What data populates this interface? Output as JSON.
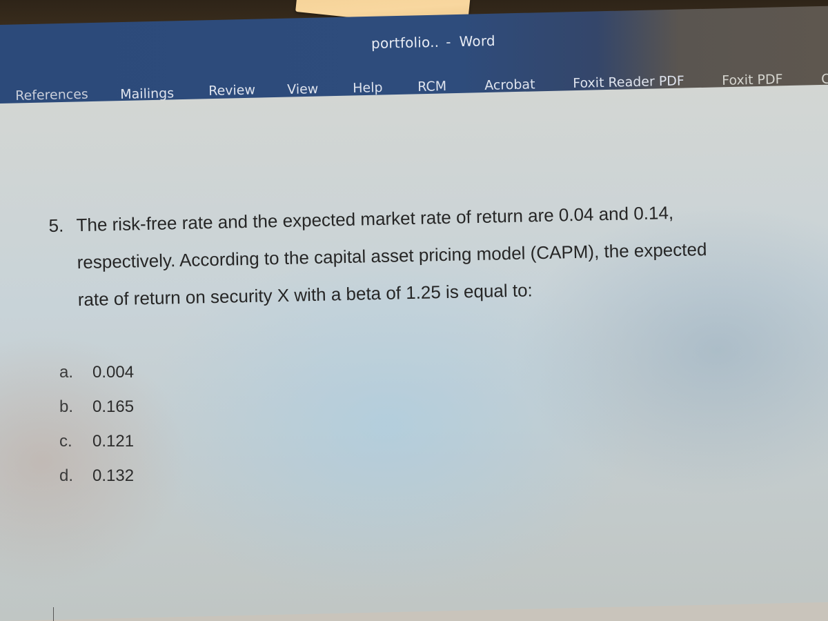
{
  "window": {
    "document_name": "portfolio..",
    "separator": "-",
    "app_name": "Word"
  },
  "ribbon": {
    "tabs": [
      {
        "label": "References"
      },
      {
        "label": "Mailings"
      },
      {
        "label": "Review"
      },
      {
        "label": "View"
      },
      {
        "label": "Help"
      },
      {
        "label": "RCM"
      },
      {
        "label": "Acrobat"
      },
      {
        "label": "Foxit Reader PDF"
      },
      {
        "label": "Foxit PDF"
      },
      {
        "label": "C"
      }
    ]
  },
  "document": {
    "question": {
      "number": "5.",
      "lines": [
        "The risk-free rate and the expected market rate of return are 0.04 and 0.14,",
        "respectively. According to the capital asset pricing model (CAPM), the expected",
        "rate of return on security X with a beta of 1.25 is equal to:"
      ]
    },
    "options": [
      {
        "letter": "a.",
        "value": "0.004"
      },
      {
        "letter": "b.",
        "value": "0.165"
      },
      {
        "letter": "c.",
        "value": "0.121"
      },
      {
        "letter": "d.",
        "value": "0.132"
      }
    ]
  },
  "colors": {
    "ribbon_blue": "#2e4c7c",
    "ribbon_text": "#dfe4ee",
    "document_text": "#262626",
    "sticky_note": "#f6d49b"
  }
}
